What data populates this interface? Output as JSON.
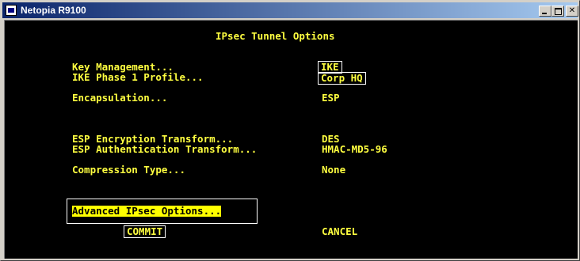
{
  "window": {
    "title": "Netopia R9100"
  },
  "screen": {
    "heading": "IPsec Tunnel Options",
    "rows": {
      "key_management": {
        "label": "Key Management...",
        "value": "IKE"
      },
      "ike_profile": {
        "label": "IKE Phase 1 Profile...",
        "value": "Corp HQ"
      },
      "encapsulation": {
        "label": "Encapsulation...",
        "value": "ESP"
      },
      "esp_encryption": {
        "label": "ESP Encryption Transform...",
        "value": "DES"
      },
      "esp_auth": {
        "label": "ESP Authentication Transform...",
        "value": "HMAC-MD5-96"
      },
      "compression": {
        "label": "Compression Type...",
        "value": "None"
      }
    },
    "advanced": "Advanced IPsec Options...",
    "commit": "COMMIT",
    "cancel": "CANCEL"
  },
  "colors": {
    "terminal_bg": "#000000",
    "terminal_text": "#ffff40",
    "highlight_bg": "#ffff00",
    "titlebar_start": "#0a246a",
    "titlebar_end": "#a6caf0"
  },
  "icons": {
    "app": "terminal-app-icon",
    "minimize": "minimize-icon",
    "maximize": "maximize-icon",
    "close": "close-icon"
  }
}
